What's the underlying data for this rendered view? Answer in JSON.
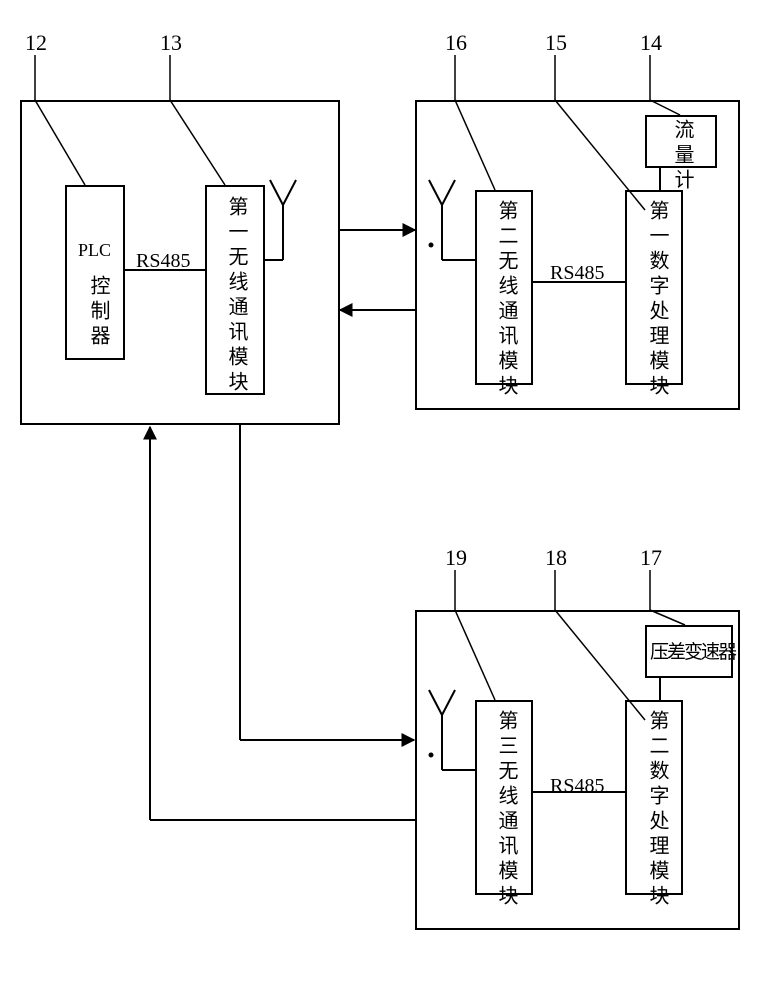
{
  "callouts": {
    "c12": "12",
    "c13": "13",
    "c14": "14",
    "c15": "15",
    "c16": "16",
    "c17": "17",
    "c18": "18",
    "c19": "19"
  },
  "blocks": {
    "plc": "PLC",
    "plc_sub": "控制器",
    "first_wireless": "第一无线通讯模块",
    "second_wireless": "第二无线通讯模块",
    "third_wireless": "第三无线通讯模块",
    "first_dsp": "第一数字处理模块",
    "second_dsp": "第二数字处理模块",
    "flowmeter": "流量计",
    "diff_transmitter": "压差变速器"
  },
  "labels": {
    "rs485": "RS485"
  }
}
